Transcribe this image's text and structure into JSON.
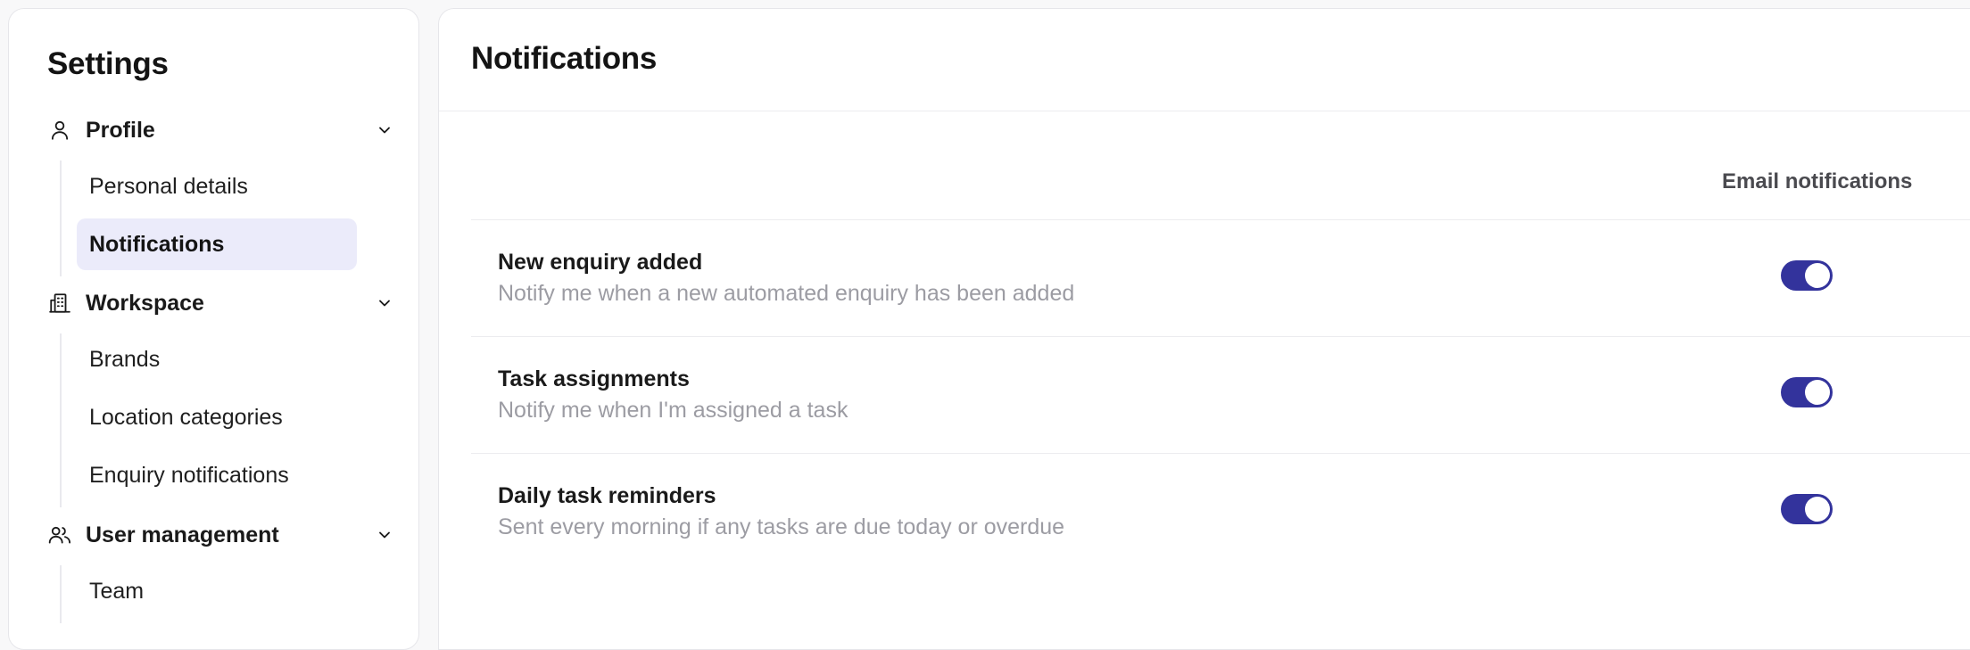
{
  "sidebar": {
    "title": "Settings",
    "groups": [
      {
        "label": "Profile",
        "icon": "user-icon",
        "items": [
          {
            "label": "Personal details",
            "active": false
          },
          {
            "label": "Notifications",
            "active": true
          }
        ]
      },
      {
        "label": "Workspace",
        "icon": "building-icon",
        "items": [
          {
            "label": "Brands",
            "active": false
          },
          {
            "label": "Location categories",
            "active": false
          },
          {
            "label": "Enquiry notifications",
            "active": false
          }
        ]
      },
      {
        "label": "User management",
        "icon": "users-icon",
        "items": [
          {
            "label": "Team",
            "active": false
          }
        ]
      }
    ]
  },
  "main": {
    "title": "Notifications",
    "column_header": "Email notifications",
    "rows": [
      {
        "title": "New enquiry added",
        "description": "Notify me when a new automated enquiry has been added",
        "enabled": true
      },
      {
        "title": "Task assignments",
        "description": "Notify me when I'm assigned a task",
        "enabled": true
      },
      {
        "title": "Daily task reminders",
        "description": "Sent every morning if any tasks are due today or overdue",
        "enabled": true
      }
    ]
  },
  "colors": {
    "accent": "#33339c",
    "active_nav_bg": "#ebebfa",
    "muted_text": "#9c9ca3"
  }
}
